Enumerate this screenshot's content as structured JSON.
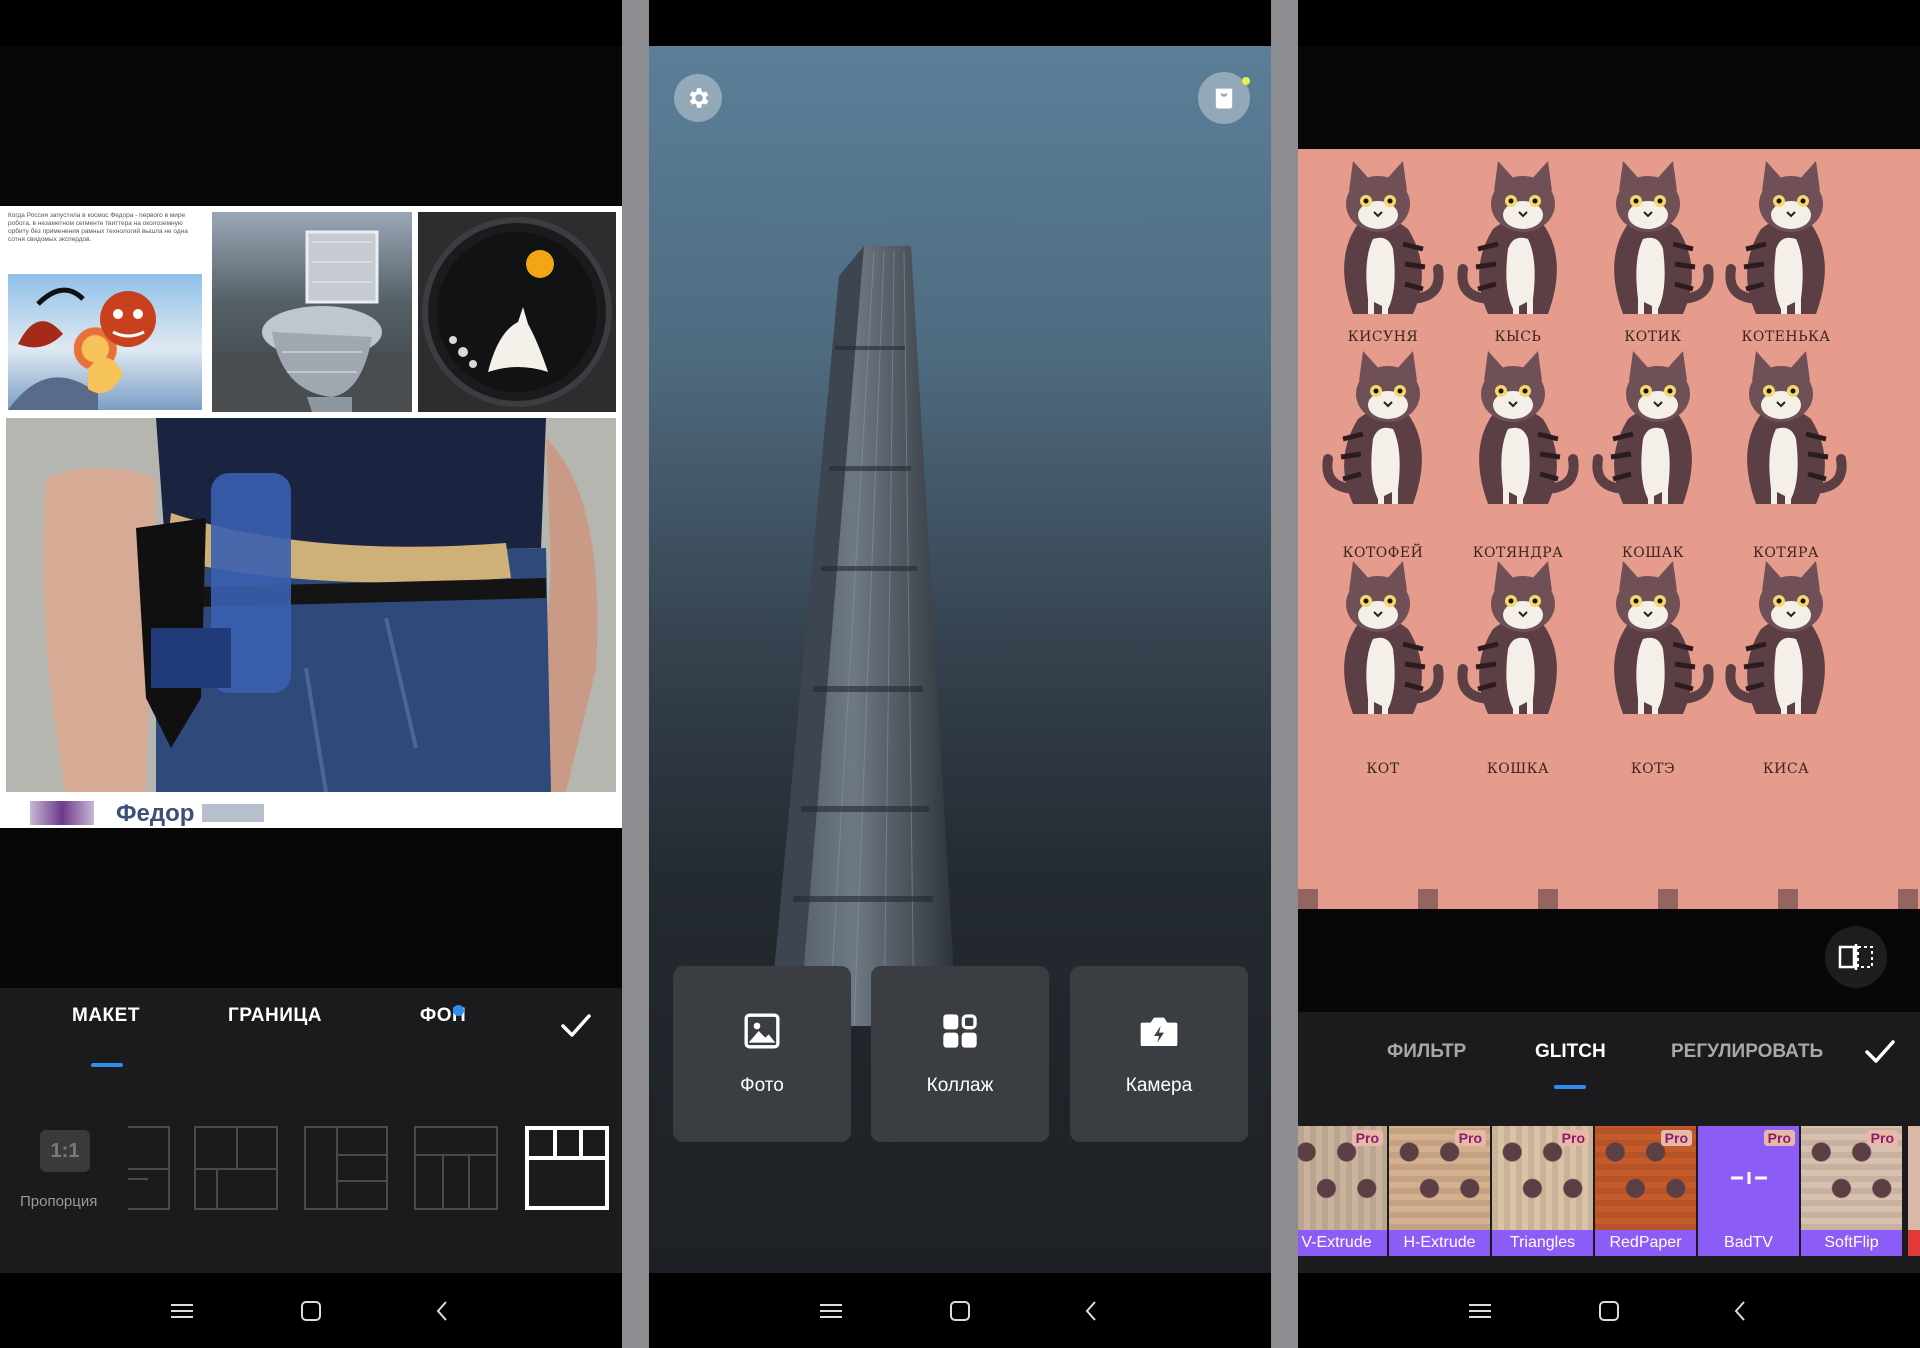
{
  "panel1": {
    "collage": {
      "news_text": "Когда Россия запустила в космос Федора - первого в мире робота, в незаметном сегменте твиттера на околоземную орбиту без применения рамных технологий вышла не одна сотня свидомых экспердов.",
      "caption": "Федор"
    },
    "tabs": [
      {
        "label": "МАКЕТ",
        "active": true
      },
      {
        "label": "ГРАНИЦА",
        "active": false
      },
      {
        "label": "ФОН",
        "active": false,
        "dot": true
      }
    ],
    "ratio_label": "1:1",
    "ratio_caption": "Пропорция"
  },
  "panel2": {
    "actions": [
      {
        "label": "Фото",
        "icon": "image-icon"
      },
      {
        "label": "Коллаж",
        "icon": "grid-icon"
      },
      {
        "label": "Камера",
        "icon": "camera-icon"
      }
    ]
  },
  "panel3": {
    "cat_names": [
      "КИСУНЯ",
      "КЫСЬ",
      "КОТИК",
      "КОТЕНЬКА",
      "КОТОФЕЙ",
      "КОТЯНДРА",
      "КОШАК",
      "КОТЯРА",
      "КОТ",
      "КОШКА",
      "КОТЭ",
      "КИСА"
    ],
    "tabs": [
      {
        "label": "ФИЛЬТР",
        "active": false
      },
      {
        "label": "GLITCH",
        "active": true
      },
      {
        "label": "РЕГУЛИРОВАТЬ",
        "active": false
      }
    ],
    "filters": [
      {
        "name": "V-Extrude",
        "pro": "Pro"
      },
      {
        "name": "H-Extrude",
        "pro": "Pro"
      },
      {
        "name": "Triangles",
        "pro": "Pro"
      },
      {
        "name": "RedPaper",
        "pro": "Pro"
      },
      {
        "name": "BadTV",
        "pro": "Pro"
      },
      {
        "name": "SoftFlip",
        "pro": "Pro"
      }
    ]
  },
  "colors": {
    "accent_blue": "#2f8cf0",
    "filter_purple": "#8b5cf6",
    "pink_background": "#e69c8c"
  }
}
